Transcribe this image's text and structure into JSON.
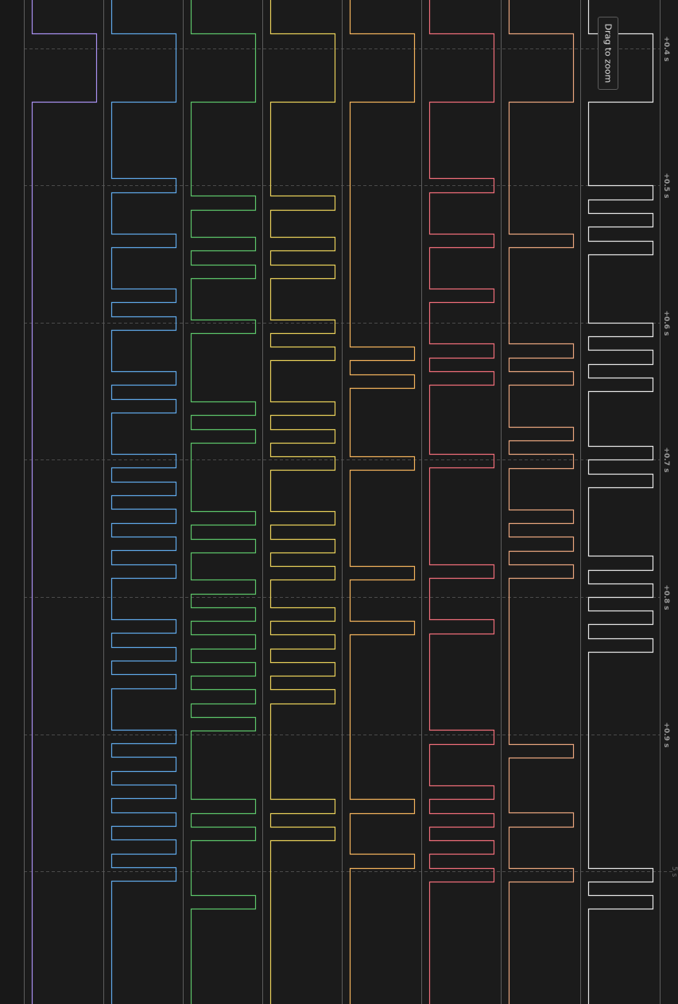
{
  "tooltip": {
    "text": "Drag to zoom"
  },
  "time_axis": {
    "unit": "s",
    "ticks": [
      {
        "label": "+0.4 s",
        "t": 0.4
      },
      {
        "label": "+0.5 s",
        "t": 0.5
      },
      {
        "label": "+0.6 s",
        "t": 0.6
      },
      {
        "label": "+0.7 s",
        "t": 0.7
      },
      {
        "label": "+0.8 s",
        "t": 0.8
      },
      {
        "label": "+0.9 s",
        "t": 0.9
      },
      {
        "label": "5 s",
        "t": 1.0
      }
    ]
  },
  "colors": {
    "background": "#1b1b1b",
    "lane_separator": "#5c5c5c",
    "grid": "#4a4a4a",
    "channels": [
      "#a890f0",
      "#5fa8e8",
      "#5cc46a",
      "#e8cf5a",
      "#f2b25c",
      "#ef6e7a",
      "#e8a57e",
      "#e6e6e6"
    ]
  },
  "channels": [
    {
      "color_index": 0,
      "initial": 0,
      "transitions": [
        0.3887,
        0.4387
      ]
    },
    {
      "color_index": 1,
      "initial": 0,
      "transitions": [
        0.3887,
        0.4387,
        0.4947,
        0.5047,
        0.5349,
        0.5449,
        0.5751,
        0.5851,
        0.5952,
        0.6052,
        0.6354,
        0.6454,
        0.6555,
        0.6655,
        0.6957,
        0.7057,
        0.7158,
        0.7258,
        0.7359,
        0.7459,
        0.756,
        0.766,
        0.7761,
        0.7861,
        0.8163,
        0.8263,
        0.8364,
        0.8464,
        0.8565,
        0.8665,
        0.8967,
        0.9067,
        0.9168,
        0.9268,
        0.9369,
        0.9469,
        0.957,
        0.967,
        0.9771,
        0.9871,
        0.9972,
        1.0072
      ]
    },
    {
      "color_index": 2,
      "initial": 0,
      "transitions": [
        0.3887,
        0.4387,
        0.5075,
        0.5175,
        0.5375,
        0.5475,
        0.5575,
        0.5675,
        0.5975,
        0.6075,
        0.6575,
        0.6675,
        0.6775,
        0.6875,
        0.7375,
        0.7475,
        0.7575,
        0.7675,
        0.7875,
        0.7975,
        0.8075,
        0.8175,
        0.8275,
        0.8375,
        0.8475,
        0.8575,
        0.8675,
        0.8775,
        0.8875,
        0.8975,
        0.9475,
        0.9575,
        0.9675,
        0.9775,
        1.0175,
        1.0275
      ]
    },
    {
      "color_index": 3,
      "initial": 0,
      "transitions": [
        0.3887,
        0.4387,
        0.5075,
        0.5175,
        0.5375,
        0.5475,
        0.5575,
        0.5675,
        0.5975,
        0.6075,
        0.6175,
        0.6275,
        0.6575,
        0.6675,
        0.6775,
        0.6875,
        0.6975,
        0.7075,
        0.7375,
        0.7475,
        0.7575,
        0.7675,
        0.7775,
        0.7875,
        0.8075,
        0.8175,
        0.8275,
        0.8375,
        0.8475,
        0.8575,
        0.8675,
        0.8775,
        0.9475,
        0.9575,
        0.9675,
        0.9775
      ]
    },
    {
      "color_index": 4,
      "initial": 0,
      "transitions": [
        0.3887,
        0.4387,
        0.6175,
        0.6275,
        0.6375,
        0.6475,
        0.6975,
        0.7075,
        0.7775,
        0.7875,
        0.8175,
        0.8275,
        0.9475,
        0.9575,
        0.9875,
        0.9975
      ]
    },
    {
      "color_index": 5,
      "initial": 0,
      "transitions": [
        0.3887,
        0.4387,
        0.4947,
        0.5047,
        0.5349,
        0.5449,
        0.5751,
        0.5851,
        0.6153,
        0.6253,
        0.6354,
        0.6454,
        0.6957,
        0.7057,
        0.7762,
        0.7862,
        0.8165,
        0.8265,
        0.897,
        0.907,
        0.9373,
        0.9473,
        0.9574,
        0.9674,
        0.9775,
        0.9875,
        0.9976,
        1.0076
      ]
    },
    {
      "color_index": 6,
      "initial": 0,
      "transitions": [
        0.3887,
        0.4387,
        0.5349,
        0.5449,
        0.6153,
        0.6253,
        0.6354,
        0.6454,
        0.6757,
        0.6857,
        0.6958,
        0.7058,
        0.7361,
        0.7461,
        0.7562,
        0.7662,
        0.7763,
        0.7863,
        0.907,
        0.917,
        0.9573,
        0.9673,
        0.9976,
        1.0076
      ]
    },
    {
      "color_index": 7,
      "initial": 0,
      "transitions": [
        0.3887,
        0.4387,
        0.5,
        0.51,
        0.52,
        0.53,
        0.54,
        0.55,
        0.6,
        0.61,
        0.62,
        0.63,
        0.64,
        0.65,
        0.69,
        0.7,
        0.71,
        0.72,
        0.77,
        0.78,
        0.79,
        0.8,
        0.81,
        0.82,
        0.83,
        0.84,
        0.9975,
        1.0075,
        1.0175,
        1.0275
      ]
    }
  ]
}
